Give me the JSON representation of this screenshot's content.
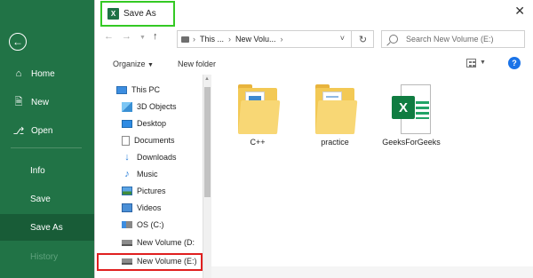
{
  "backstage": {
    "back_icon": "arrow-left-icon",
    "items": [
      {
        "label": "Home",
        "icon": "home-icon"
      },
      {
        "label": "New",
        "icon": "new-document-icon"
      },
      {
        "label": "Open",
        "icon": "folder-open-icon"
      },
      {
        "label": "Info"
      },
      {
        "label": "Save"
      },
      {
        "label": "Save As"
      },
      {
        "label": "History"
      }
    ],
    "active_label": "Save As",
    "colors": {
      "background": "#217346",
      "active": "#185c37"
    }
  },
  "dialog": {
    "title": "Save As",
    "app_icon_letter": "X",
    "highlight_color": "#34c924",
    "address": {
      "parts": [
        "This ...",
        "New Volu..."
      ]
    },
    "search": {
      "placeholder": "Search New Volume (E:)"
    },
    "toolbar": {
      "organize": "Organize",
      "new_folder": "New folder",
      "help": "?"
    },
    "tree": [
      {
        "label": "This PC",
        "icon": "pc-icon"
      },
      {
        "label": "3D Objects",
        "icon": "cube-3d-icon"
      },
      {
        "label": "Desktop",
        "icon": "desktop-icon"
      },
      {
        "label": "Documents",
        "icon": "documents-icon"
      },
      {
        "label": "Downloads",
        "icon": "download-icon"
      },
      {
        "label": "Music",
        "icon": "music-note-icon"
      },
      {
        "label": "Pictures",
        "icon": "pictures-icon"
      },
      {
        "label": "Videos",
        "icon": "video-icon"
      },
      {
        "label": "OS (C:)",
        "icon": "os-drive-icon"
      },
      {
        "label": "New Volume (D:",
        "icon": "drive-icon"
      },
      {
        "label": "New Volume (E:)",
        "icon": "drive-icon"
      }
    ],
    "selected_tree_item": "New Volume (E:)",
    "selection_color": "#e01f1f",
    "files": [
      {
        "name": "C++",
        "icon": "folder-icon"
      },
      {
        "name": "practice",
        "icon": "folder-icon"
      },
      {
        "name": "GeeksForGeeks",
        "icon": "excel-file-icon"
      }
    ]
  }
}
